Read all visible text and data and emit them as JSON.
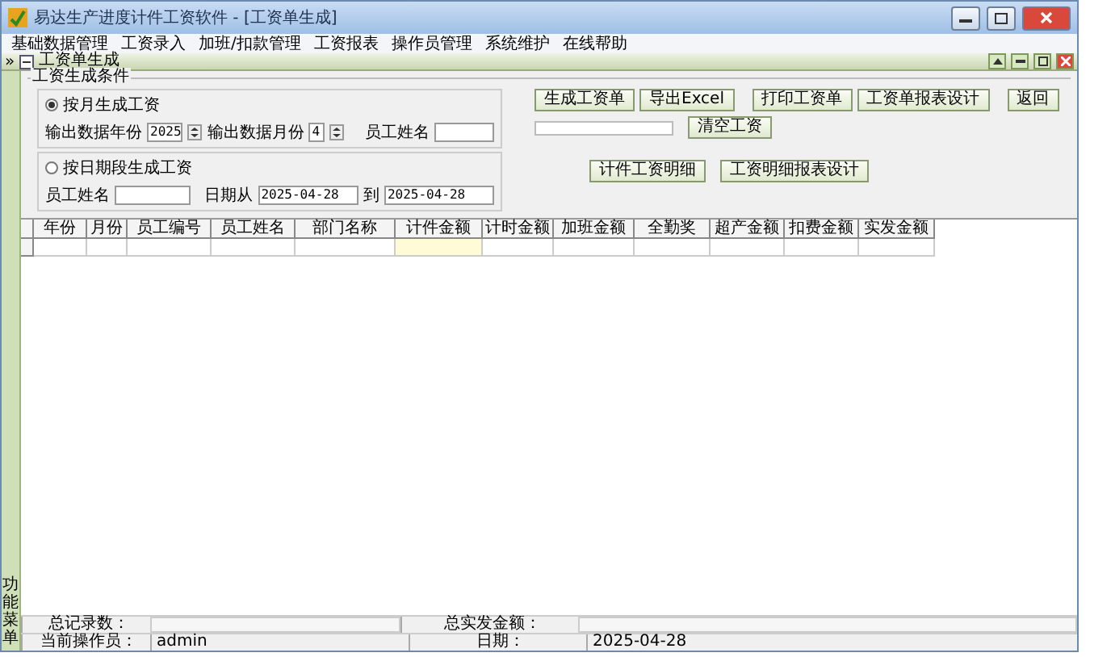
{
  "window": {
    "title": "易达生产进度计件工资软件 - [工资单生成]"
  },
  "menu": [
    "基础数据管理",
    "工资录入",
    "加班/扣款管理",
    "工资报表",
    "操作员管理",
    "系统维护",
    "在线帮助"
  ],
  "child_window": {
    "expander": "»",
    "title": "工资单生成"
  },
  "sidebar": {
    "label": "功能菜单"
  },
  "conditions": {
    "title": "工资生成条件",
    "by_month": {
      "label": "按月生成工资",
      "selected": true,
      "year_label": "输出数据年份",
      "year": "2025",
      "month_label": "输出数据月份",
      "month": "4",
      "name_label": "员工姓名"
    },
    "by_date": {
      "label": "按日期段生成工资",
      "selected": false,
      "name_label": "员工姓名",
      "from_label": "日期从",
      "from": "2025-04-28",
      "to_label": "到",
      "to": "2025-04-28"
    }
  },
  "buttons_row1": [
    "生成工资单",
    "导出Excel",
    "打印工资单",
    "工资单报表设计",
    "返回"
  ],
  "progress": {
    "level": 0
  },
  "clear_button": "清空工资",
  "buttons_row2": [
    "计件工资明细",
    "工资明细报表设计"
  ],
  "table": {
    "columns": [
      {
        "label": "年份",
        "highlighted": false
      },
      {
        "label": "月份",
        "highlighted": false
      },
      {
        "label": "员工编号",
        "highlighted": false
      },
      {
        "label": "员工姓名",
        "highlighted": false
      },
      {
        "label": "部门名称",
        "highlighted": false
      },
      {
        "label": "计件金额",
        "highlighted": true
      },
      {
        "label": "计时金额",
        "highlighted": false
      },
      {
        "label": "加班金额",
        "highlighted": false
      },
      {
        "label": "全勤奖",
        "highlighted": false
      },
      {
        "label": "超产金额",
        "highlighted": false
      },
      {
        "label": "扣费金额",
        "highlighted": false
      },
      {
        "label": "实发金额",
        "highlighted": false
      }
    ]
  },
  "summary": {
    "count_label": "总记录数：",
    "total_label": "总实发金额："
  },
  "status_bar": {
    "operator_label": "当前操作员：",
    "operator": "admin",
    "date_label": "日期：",
    "date": "2025-04-28"
  }
}
